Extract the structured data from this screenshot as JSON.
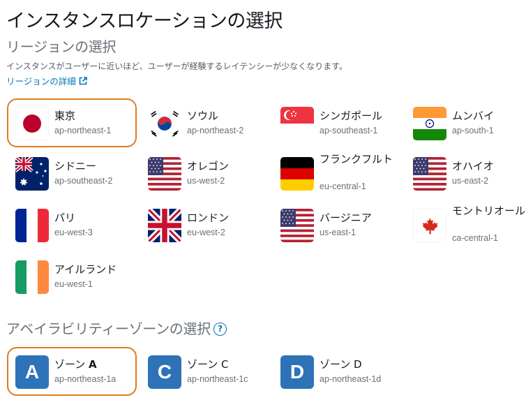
{
  "page": {
    "title": "インスタンスロケーションの選択"
  },
  "region_section": {
    "title": "リージョンの選択",
    "description": "インスタンスがユーザーに近いほど、ユーザーが経験するレイテンシーが少なくなります。",
    "details_link": "リージョンの詳細",
    "regions": [
      {
        "name": "東京",
        "code": "ap-northeast-1",
        "flag": "japan-flag",
        "selected": true
      },
      {
        "name": "ソウル",
        "code": "ap-northeast-2",
        "flag": "south-korea-flag",
        "selected": false
      },
      {
        "name": "シンガポール",
        "code": "ap-southeast-1",
        "flag": "singapore-flag",
        "selected": false
      },
      {
        "name": "ムンバイ",
        "code": "ap-south-1",
        "flag": "india-flag",
        "selected": false
      },
      {
        "name": "シドニー",
        "code": "ap-southeast-2",
        "flag": "australia-flag",
        "selected": false
      },
      {
        "name": "オレゴン",
        "code": "us-west-2",
        "flag": "usa-flag",
        "selected": false
      },
      {
        "name": "フランクフルト",
        "code": "eu-central-1",
        "flag": "germany-flag",
        "selected": false
      },
      {
        "name": "オハイオ",
        "code": "us-east-2",
        "flag": "usa-flag",
        "selected": false
      },
      {
        "name": "パリ",
        "code": "eu-west-3",
        "flag": "france-flag",
        "selected": false
      },
      {
        "name": "ロンドン",
        "code": "eu-west-2",
        "flag": "uk-flag",
        "selected": false
      },
      {
        "name": "バージニア",
        "code": "us-east-1",
        "flag": "usa-flag",
        "selected": false
      },
      {
        "name": "モントリオール",
        "code": "ca-central-1",
        "flag": "canada-flag",
        "selected": false
      },
      {
        "name": "アイルランド",
        "code": "eu-west-1",
        "flag": "ireland-flag",
        "selected": false
      }
    ]
  },
  "zone_section": {
    "title": "アベイラビリティーゾーンの選択",
    "help_icon": "?",
    "zones": [
      {
        "badge": "A",
        "name": "ゾーン",
        "letter": "A",
        "code": "ap-northeast-1a",
        "selected": true
      },
      {
        "badge": "C",
        "name": "ゾーン",
        "letter": "C",
        "code": "ap-northeast-1c",
        "selected": false
      },
      {
        "badge": "D",
        "name": "ゾーン",
        "letter": "D",
        "code": "ap-northeast-1d",
        "selected": false
      }
    ]
  },
  "colors": {
    "selected_border": "#e07b1f",
    "link": "#0073bb",
    "zone_badge": "#2e73b8"
  }
}
